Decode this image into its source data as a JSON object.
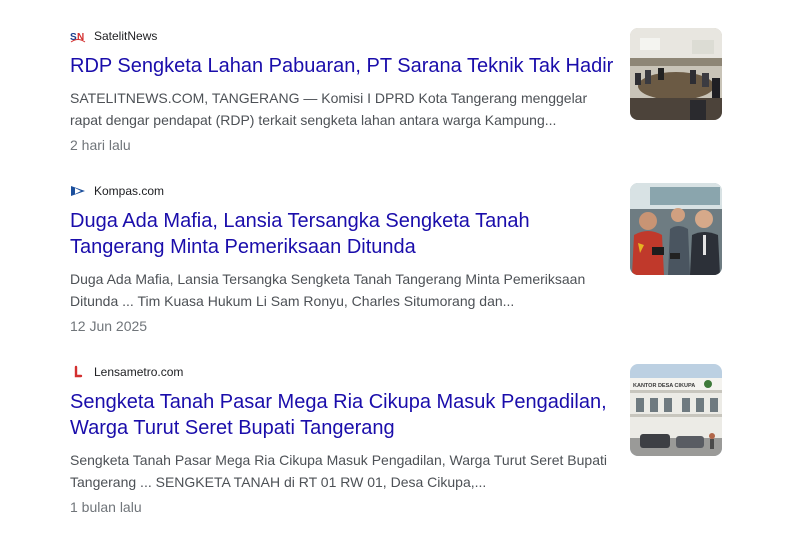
{
  "results": [
    {
      "source": "SatelitNews",
      "favicon_text": "SN",
      "favicon_icon": "satelitnews-logo-icon",
      "title": "RDP Sengketa Lahan Pabuaran, PT Sarana Teknik Tak Hadir",
      "snippet": "SATELITNEWS.COM, TANGERANG — Komisi I DPRD Kota Tangerang menggelar rapat dengar pendapat (RDP) terkait sengketa lahan antara warga Kampung...",
      "time": "2 hari lalu",
      "thumbnail": "meeting-room-photo"
    },
    {
      "source": "Kompas.com",
      "favicon_text": "",
      "favicon_icon": "kompas-logo-icon",
      "title": "Duga Ada Mafia, Lansia Tersangka Sengketa Tanah Tangerang Minta Pemeriksaan Ditunda",
      "snippet": "Duga Ada Mafia, Lansia Tersangka Sengketa Tanah Tangerang Minta Pemeriksaan Ditunda ... Tim Kuasa Hukum Li Sam Ronyu, Charles Situmorang dan...",
      "time": "12 Jun 2025",
      "thumbnail": "press-interview-photo"
    },
    {
      "source": "Lensametro.com",
      "favicon_text": "L",
      "favicon_icon": "lensametro-logo-icon",
      "title": "Sengketa Tanah Pasar Mega Ria Cikupa Masuk Pengadilan, Warga Turut Seret Bupati Tangerang",
      "snippet": "Sengketa Tanah Pasar Mega Ria Cikupa Masuk Pengadilan, Warga Turut Seret Bupati Tangerang ... SENGKETA TANAH di RT 01 RW 01, Desa Cikupa,...",
      "time": "1 bulan lalu",
      "thumbnail": "village-office-photo",
      "thumbnail_sign": "KANTOR DESA CIKUPA"
    }
  ],
  "colors": {
    "headline": "#1a0dab",
    "snippet": "#4d5156",
    "time": "#70757a",
    "source": "#202124"
  }
}
